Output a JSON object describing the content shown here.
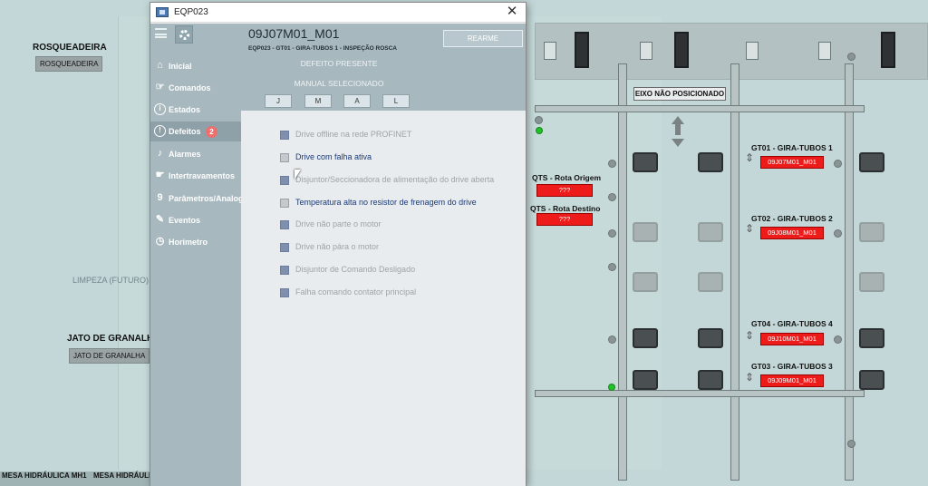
{
  "background": {
    "rosqueadeira": {
      "label": "ROSQUEADEIRA",
      "button": "ROSQUEADEIRA"
    },
    "limpeza_label": "LIMPEZA (FUTURO)",
    "jato": {
      "label": "JATO DE GRANALHA",
      "button": "JATO DE GRANALHA"
    },
    "bottom_labels": [
      "MESA HIDRÁULICA MH1",
      "MESA HIDRÁULI"
    ],
    "eixo_label": "EIXO NÃO POSICIONADO",
    "qts": [
      {
        "label": "QTS - Rota Origem",
        "value": "???"
      },
      {
        "label": "QTS - Rota Destino",
        "value": "???"
      }
    ],
    "stations": [
      {
        "label": "GT01 - GIRA-TUBOS 1",
        "code": "09J07M01_M01"
      },
      {
        "label": "GT02 - GIRA-TUBOS 2",
        "code": "09J08M01_M01"
      },
      {
        "label": "GT04 - GIRA-TUBOS 4",
        "code": "09J10M01_M01"
      },
      {
        "label": "GT03 - GIRA-TUBOS 3",
        "code": "09J09M01_M01"
      }
    ]
  },
  "window": {
    "title": "EQP023",
    "close_glyph": "✕"
  },
  "sidebar": {
    "items": [
      {
        "label": "Inicial",
        "icon": "home-icon",
        "glyph": "⌂"
      },
      {
        "label": "Comandos",
        "icon": "hand-icon",
        "glyph": "☞"
      },
      {
        "label": "Estados",
        "icon": "info-icon",
        "glyph": "i"
      },
      {
        "label": "Defeitos",
        "icon": "warning-icon",
        "glyph": "!",
        "badge": "2",
        "active": true
      },
      {
        "label": "Alarmes",
        "icon": "bell-icon",
        "glyph": "♪"
      },
      {
        "label": "Intertravamentos",
        "icon": "hand-lock-icon",
        "glyph": "☛"
      },
      {
        "label": "Parâmetros/Analog.",
        "icon": "nine-icon",
        "glyph": "9"
      },
      {
        "label": "Eventos",
        "icon": "pin-icon",
        "glyph": "✎"
      },
      {
        "label": "Horimetro",
        "icon": "clock-icon",
        "glyph": "◷"
      }
    ]
  },
  "header": {
    "title": "09J07M01_M01",
    "subtitle": "EQP023 - GT01 - GIRA-TUBOS 1 - INSPEÇÃO ROSCA",
    "rearme": "REARME",
    "status": "DEFEITO PRESENTE",
    "manual": "MANUAL SELECIONADO",
    "modes": [
      "J",
      "M",
      "A",
      "L"
    ]
  },
  "faults": [
    {
      "text": "Drive offline na rede PROFINET",
      "active": false
    },
    {
      "text": "Drive com falha ativa",
      "active": true
    },
    {
      "text": "Disjuntor/Seccionadora de alimentação do drive aberta",
      "active": false
    },
    {
      "text": "Temperatura alta no resistor de frenagem do drive",
      "active": true
    },
    {
      "text": "Drive não parte o motor",
      "active": false
    },
    {
      "text": "Drive não pára o motor",
      "active": false
    },
    {
      "text": "Disjuntor de Comando Desligado",
      "active": false
    },
    {
      "text": "Falha comando contator principal",
      "active": false
    }
  ],
  "colors": {
    "sidebar": "#a8b8bf",
    "alarm_red": "#ee1b1b",
    "active_fault_text": "#1b3a7a",
    "badge": "#ef6f6f"
  }
}
